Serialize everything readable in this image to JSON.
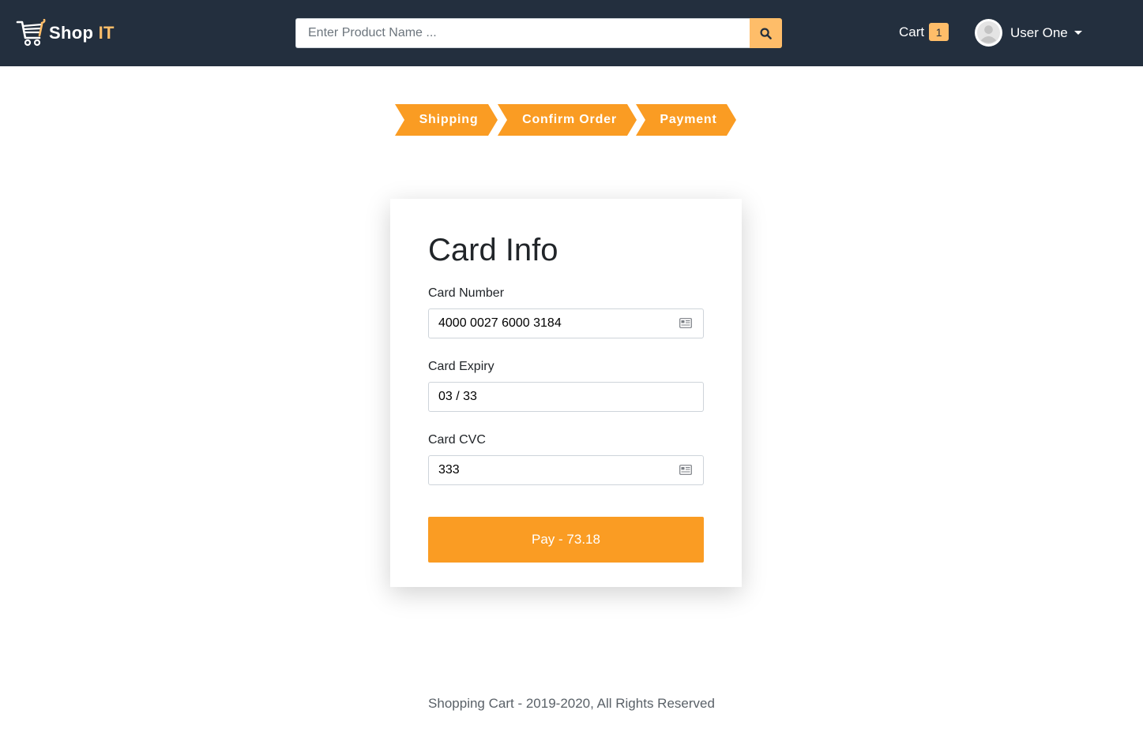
{
  "navbar": {
    "brand_main": "Shop",
    "brand_accent": "IT",
    "search_placeholder": "Enter Product Name ...",
    "cart_label": "Cart",
    "cart_count": "1",
    "user_name": "User One"
  },
  "steps": [
    {
      "label": "Shipping"
    },
    {
      "label": "Confirm Order"
    },
    {
      "label": "Payment"
    }
  ],
  "card": {
    "title": "Card Info",
    "card_number_label": "Card Number",
    "card_number_value": "4000 0027 6000 3184",
    "card_expiry_label": "Card Expiry",
    "card_expiry_value": "03 / 33",
    "card_cvc_label": "Card CVC",
    "card_cvc_value": "333",
    "pay_button": "Pay - 73.18"
  },
  "footer": {
    "text": "Shopping Cart - 2019-2020, All Rights Reserved"
  },
  "colors": {
    "navbar_bg": "#232f3e",
    "accent": "#febd69",
    "step_orange": "#fa9c23"
  }
}
